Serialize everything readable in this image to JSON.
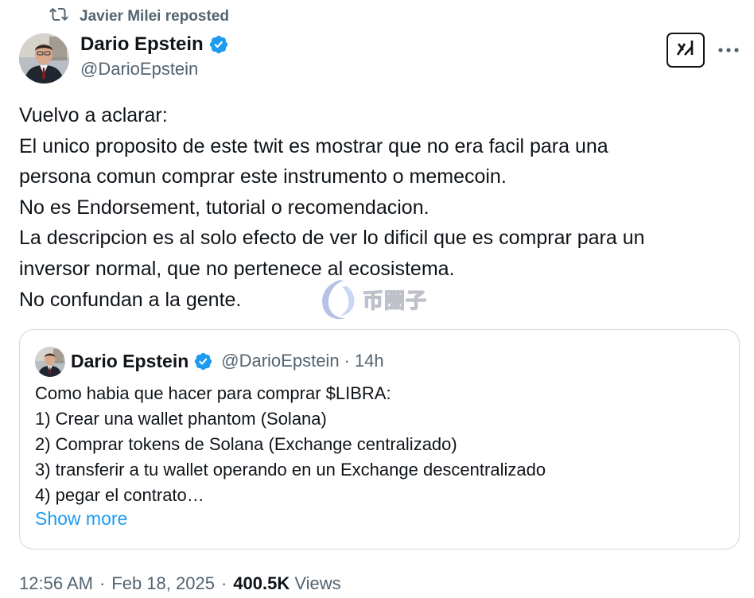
{
  "repost": {
    "icon": "repost-icon",
    "text": "Javier Milei reposted"
  },
  "author": {
    "name": "Dario Epstein",
    "handle": "@DarioEpstein",
    "verified": true
  },
  "actions": {
    "grok_icon": "grok-icon",
    "more_icon": "more-icon"
  },
  "tweet": {
    "lines": [
      "Vuelvo a aclarar:",
      "El unico proposito de este twit es mostrar que no era facil para una",
      "persona comun comprar este instrumento o memecoin.",
      "No es Endorsement, tutorial o recomendacion.",
      "La descripcion es al solo efecto de ver lo dificil que es comprar para un",
      "inversor normal, que no pertenece al ecosistema.",
      "No confundan a la gente."
    ]
  },
  "watermark": {
    "text": "币圈子"
  },
  "quote": {
    "name": "Dario Epstein",
    "handle": "@DarioEpstein",
    "time": "14h",
    "lines": [
      "Como habia que hacer para comprar $LIBRA:",
      "1) Crear una wallet phantom (Solana)",
      "2) Comprar tokens de Solana (Exchange centralizado)",
      "3) transferir a tu wallet operando en un Exchange descentralizado",
      "4) pegar el contrato…"
    ],
    "show_more": "Show more"
  },
  "meta": {
    "time": "12:56 AM",
    "date": "Feb 18, 2025",
    "views_count": "400.5K",
    "views_label": "Views"
  },
  "colors": {
    "text": "#0f1419",
    "secondary": "#536471",
    "link": "#1d9bf0",
    "verified": "#1d9bf0",
    "border": "#cfd9de"
  }
}
